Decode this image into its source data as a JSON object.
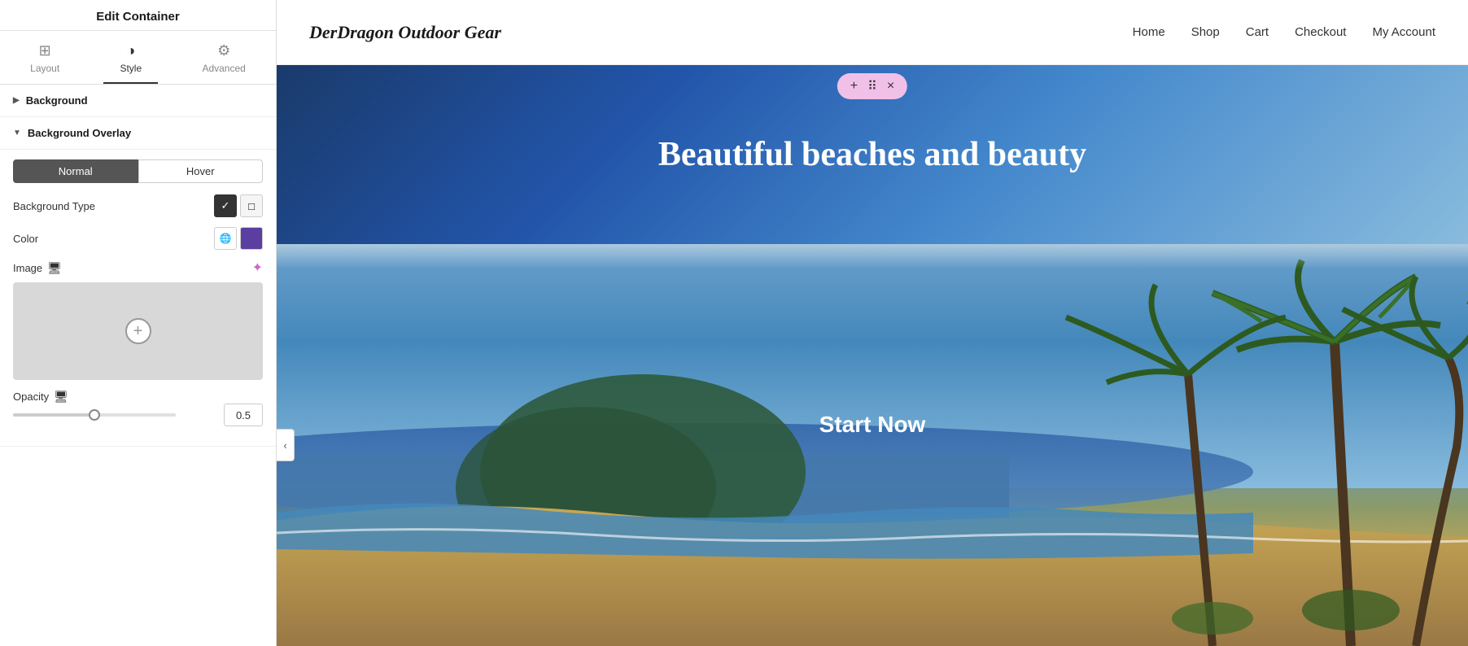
{
  "panel": {
    "title": "Edit Container",
    "tabs": [
      {
        "id": "layout",
        "label": "Layout",
        "icon": "⊞"
      },
      {
        "id": "style",
        "label": "Style",
        "icon": "◑"
      },
      {
        "id": "advanced",
        "label": "Advanced",
        "icon": "⚙"
      }
    ],
    "active_tab": "style",
    "sections": {
      "background": {
        "label": "Background",
        "collapsed": true,
        "arrow": "▶"
      },
      "background_overlay": {
        "label": "Background Overlay",
        "collapsed": false,
        "arrow": "▼"
      }
    },
    "normal_hover": {
      "normal_label": "Normal",
      "hover_label": "Hover",
      "active": "normal"
    },
    "background_type": {
      "label": "Background Type",
      "option_solid": "✓",
      "option_gradient": "□"
    },
    "color": {
      "label": "Color",
      "globe_icon": "🌐",
      "swatch_color": "#5b3fa0"
    },
    "image": {
      "label": "Image",
      "monitor_icon": "🖥",
      "magic_icon": "✦"
    },
    "opacity": {
      "label": "Opacity",
      "monitor_icon": "🖥",
      "value": "0.5",
      "slider_percent": 50
    }
  },
  "site": {
    "logo": "DerDragon Outdoor Gear",
    "nav_links": [
      "Home",
      "Shop",
      "Cart",
      "Checkout",
      "My Account"
    ]
  },
  "toolbar": {
    "add_icon": "+",
    "drag_icon": "⠿",
    "close_icon": "×"
  },
  "hero": {
    "title": "Beautiful beaches and beauty"
  },
  "beach": {
    "cta": "Start Now"
  }
}
